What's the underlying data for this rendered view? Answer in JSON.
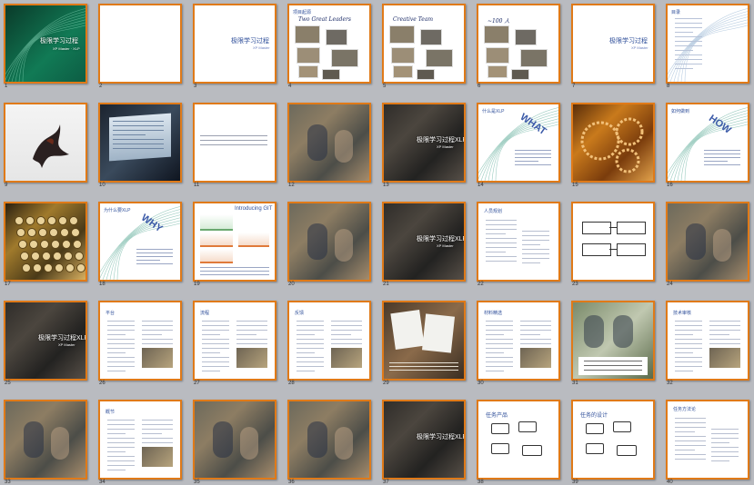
{
  "colors": {
    "slide_border": "#e07a18",
    "background": "#b9bbc0",
    "accent_blue": "#2f4f9a"
  },
  "slides": [
    {
      "num": "1",
      "kind": "green-title",
      "title": "极限学习过程",
      "subtitle": "XP Master · XLP"
    },
    {
      "num": "2",
      "kind": "blank"
    },
    {
      "num": "3",
      "kind": "title",
      "title": "极限学习过程",
      "subtitle": "XP Master"
    },
    {
      "num": "4",
      "kind": "hand-photos",
      "heading": "项目起源",
      "hand1": "Two Great Leaders"
    },
    {
      "num": "5",
      "kind": "hand-photos",
      "heading": "",
      "hand1": "Creative Team"
    },
    {
      "num": "6",
      "kind": "hand-photos",
      "heading": "",
      "hand1": "~100 人"
    },
    {
      "num": "7",
      "kind": "title",
      "title": "极限学习过程",
      "subtitle": "XP Master"
    },
    {
      "num": "8",
      "kind": "outline",
      "title": "目录"
    },
    {
      "num": "9",
      "kind": "splash"
    },
    {
      "num": "10",
      "kind": "photo-screen"
    },
    {
      "num": "11",
      "kind": "text-lines"
    },
    {
      "num": "12",
      "kind": "photo-class"
    },
    {
      "num": "13",
      "kind": "photo-title",
      "title": "极限学习过程XLP",
      "subtitle": "XP Master"
    },
    {
      "num": "14",
      "kind": "word-art",
      "word": "WHAT",
      "heading": "什么是XLP"
    },
    {
      "num": "15",
      "kind": "photo-gears"
    },
    {
      "num": "16",
      "kind": "word-art",
      "word": "HOW",
      "heading": "如何做到"
    },
    {
      "num": "17",
      "kind": "photo-typewriter"
    },
    {
      "num": "18",
      "kind": "word-art",
      "word": "WHY",
      "heading": "为什么要XLP"
    },
    {
      "num": "19",
      "kind": "chart-slide",
      "heading": "Introducing GIT"
    },
    {
      "num": "20",
      "kind": "photo-class"
    },
    {
      "num": "21",
      "kind": "photo-title",
      "title": "极限学习过程XLP",
      "subtitle": "XP Master"
    },
    {
      "num": "22",
      "kind": "text-list",
      "heading": "人员规划"
    },
    {
      "num": "23",
      "kind": "flow"
    },
    {
      "num": "24",
      "kind": "photo-class"
    },
    {
      "num": "25",
      "kind": "photo-title",
      "title": "极限学习过程XLP",
      "subtitle": "XP Master"
    },
    {
      "num": "26",
      "kind": "article",
      "heading": "平台"
    },
    {
      "num": "27",
      "kind": "article",
      "heading": "流程"
    },
    {
      "num": "28",
      "kind": "article",
      "heading": "反馈"
    },
    {
      "num": "29",
      "kind": "photo-papers"
    },
    {
      "num": "30",
      "kind": "article",
      "heading": "材料精选"
    },
    {
      "num": "31",
      "kind": "photo-people"
    },
    {
      "num": "32",
      "kind": "article",
      "heading": "技术审核"
    },
    {
      "num": "33",
      "kind": "photo-class"
    },
    {
      "num": "34",
      "kind": "article",
      "heading": "概节"
    },
    {
      "num": "35",
      "kind": "photo-class"
    },
    {
      "num": "36",
      "kind": "photo-class"
    },
    {
      "num": "37",
      "kind": "photo-title",
      "title": "极限学习过程XLP",
      "subtitle": ""
    },
    {
      "num": "38",
      "kind": "flow2",
      "heading": "任务产品"
    },
    {
      "num": "39",
      "kind": "flow2",
      "heading": "任务的设计"
    },
    {
      "num": "40",
      "kind": "text-list",
      "heading": "任务方法论"
    }
  ]
}
